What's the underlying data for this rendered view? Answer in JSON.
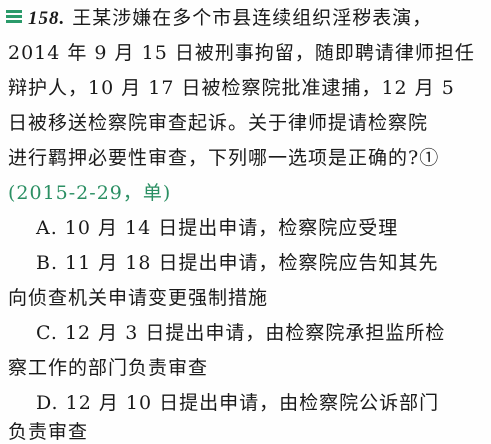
{
  "question": {
    "number": "158.",
    "lines": [
      "王某涉嫌在多个市县连续组织淫秽表演，",
      "2014 年 9 月 15 日被刑事拘留，随即聘请律师担任",
      "辩护人，10 月 17 日被检察院批准逮捕，12 月 5",
      "日被移送检察院审查起诉。关于律师提请检察院",
      "进行羁押必要性审查，下列哪一选项是正确的?①"
    ],
    "source": "(2015-2-29，单)"
  },
  "options": {
    "a": [
      "A. 10 月 14 日提出申请，检察院应受理"
    ],
    "b": [
      "B. 11 月 18 日提出申请，检察院应告知其先",
      "向侦查机关申请变更强制措施"
    ],
    "c": [
      "C. 12 月 3 日提出申请，由检察院承担监所检",
      "察工作的部门负责审查"
    ],
    "d": [
      "D. 12 月 10 日提出申请，由检察院公诉部门",
      "负责审查"
    ]
  },
  "colors": {
    "accent": "#2b8f63",
    "text": "#1a1a1a"
  },
  "icons": {
    "question_marker": "question-list-icon"
  }
}
